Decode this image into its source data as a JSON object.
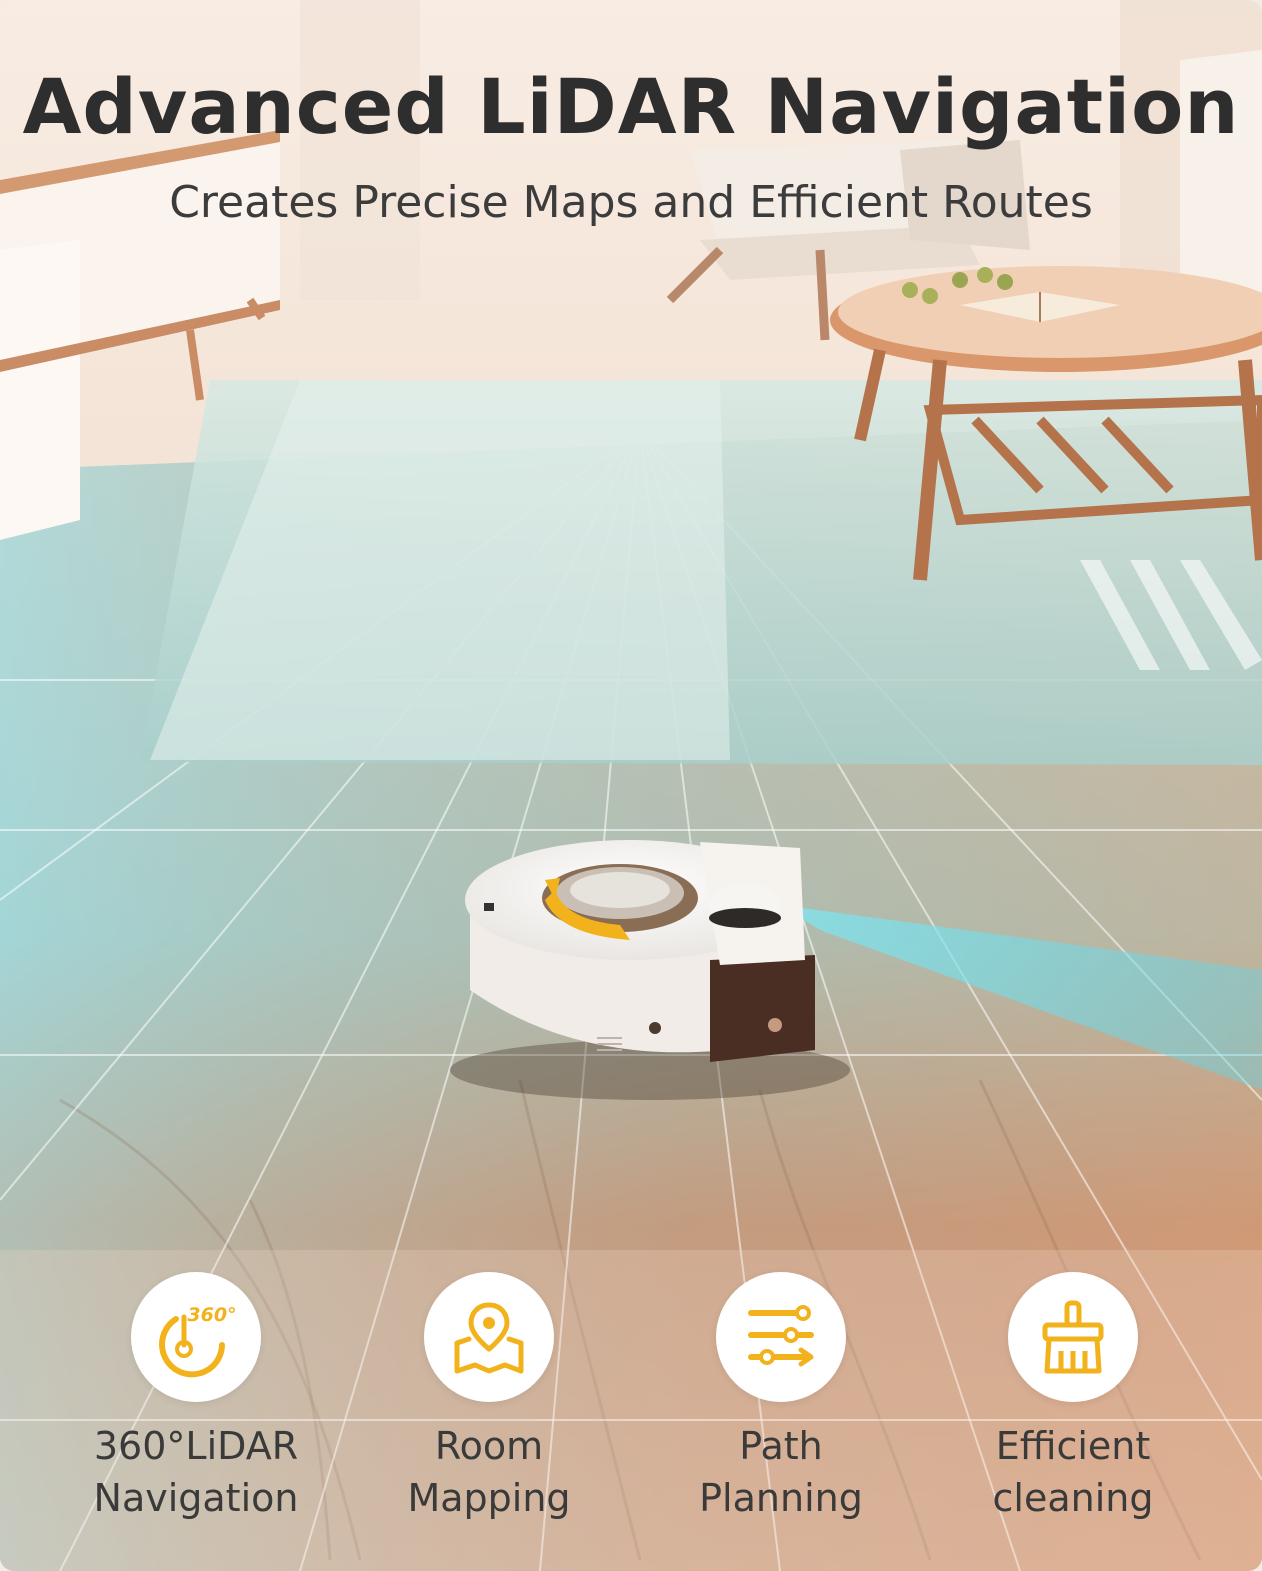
{
  "headline": "Advanced LiDAR Navigation",
  "subheadline": "Creates Precise Maps and Efficient Routes",
  "accent_color": "#f2b21c",
  "features": [
    {
      "icon": "lidar-360-icon",
      "badge": "360°",
      "line1": "360°LiDAR",
      "line2": "Navigation"
    },
    {
      "icon": "map-pin-icon",
      "line1": "Room",
      "line2": "Mapping"
    },
    {
      "icon": "route-path-icon",
      "line1": "Path",
      "line2": "Planning"
    },
    {
      "icon": "cleaning-brush-icon",
      "line1": "Efficient",
      "line2": "cleaning"
    }
  ]
}
